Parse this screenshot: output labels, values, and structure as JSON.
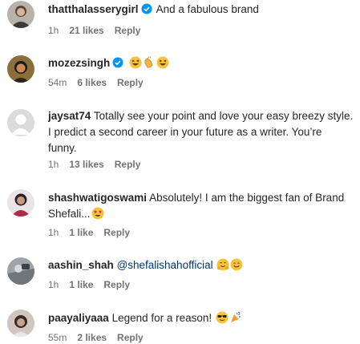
{
  "comments": [
    {
      "username": "thatthalasserygirl",
      "verified": true,
      "text": "And a fabulous brand",
      "time": "1h",
      "likes": "21 likes",
      "reply": "Reply"
    },
    {
      "username": "mozezsingh",
      "verified": true,
      "text": "",
      "emojis": [
        "grinning-squinting-face",
        "clapping-hands",
        "grinning-squinting-face"
      ],
      "time": "54m",
      "likes": "6 likes",
      "reply": "Reply"
    },
    {
      "username": "jaysat74",
      "verified": false,
      "text_lines": [
        "Totally see your point and love your easy breezy style.",
        "I predict a second career in your future as a writer. You’re",
        "funny."
      ],
      "time": "1h",
      "likes": "13 likes",
      "reply": "Reply"
    },
    {
      "username": "shashwatigoswami",
      "verified": false,
      "text_lines": [
        "Absolutely! I am the biggest fan of Brand",
        "Shefali..."
      ],
      "emojis": [
        "star-struck-face"
      ],
      "time": "1h",
      "likes": "1 like",
      "reply": "Reply"
    },
    {
      "username": "aashin_shah",
      "verified": false,
      "mention": "@shefalishahofficial",
      "emojis": [
        "hugging-face",
        "smiling-face"
      ],
      "time": "1h",
      "likes": "1 like",
      "reply": "Reply"
    },
    {
      "username": "paayaliyaaa",
      "verified": false,
      "text": "Legend for a reason!",
      "emojis": [
        "sunglasses-face",
        "party-popper"
      ],
      "time": "55m",
      "likes": "2 likes",
      "reply": "Reply"
    }
  ],
  "colors": {
    "text": "#262626",
    "meta": "#737373",
    "verified": "#0095f6",
    "mention": "#00376b"
  }
}
